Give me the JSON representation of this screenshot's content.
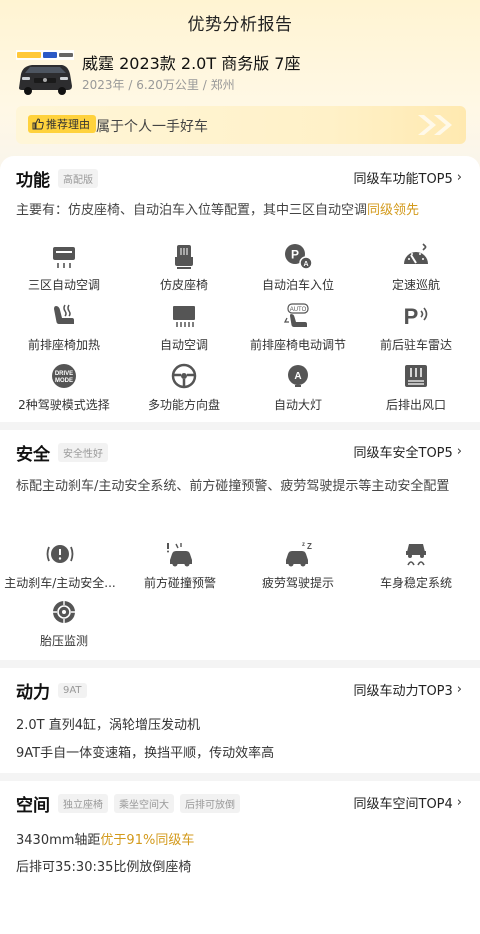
{
  "header": {
    "title": "优势分析报告"
  },
  "car": {
    "name": "威霆 2023款 2.0T 商务版 7座",
    "meta": "2023年 / 6.20万公里 / 郑州"
  },
  "reason": {
    "tag": "推荐理由",
    "text": "属于个人一手好车"
  },
  "function": {
    "title": "功能",
    "badge": "高配版",
    "top_link": "同级车功能TOP5",
    "desc_prefix": "主要有：仿皮座椅、自动泊车入位等配置，其中三区自动空调",
    "desc_highlight": "同级领先",
    "items": [
      {
        "label": "三区自动空调",
        "icon": "ac-icon"
      },
      {
        "label": "仿皮座椅",
        "icon": "seat-icon"
      },
      {
        "label": "自动泊车入位",
        "icon": "auto-park-icon"
      },
      {
        "label": "定速巡航",
        "icon": "cruise-icon"
      },
      {
        "label": "前排座椅加热",
        "icon": "seat-heat-icon"
      },
      {
        "label": "自动空调",
        "icon": "auto-ac-icon"
      },
      {
        "label": "前排座椅电动调节",
        "icon": "power-seat-icon"
      },
      {
        "label": "前后驻车雷达",
        "icon": "parking-radar-icon"
      },
      {
        "label": "2种驾驶模式选择",
        "icon": "drive-mode-icon"
      },
      {
        "label": "多功能方向盘",
        "icon": "steering-wheel-icon"
      },
      {
        "label": "自动大灯",
        "icon": "auto-light-icon"
      },
      {
        "label": "后排出风口",
        "icon": "rear-vent-icon"
      }
    ],
    "drive_mode_text": [
      "DRIVE",
      "MODE"
    ]
  },
  "safety": {
    "title": "安全",
    "badge": "安全性好",
    "top_link": "同级车安全TOP5",
    "desc": "标配主动刹车/主动安全系统、前方碰撞预警、疲劳驾驶提示等主动安全配置",
    "items": [
      {
        "label": "主动刹车/主动安全...",
        "icon": "brake-warning-icon"
      },
      {
        "label": "前方碰撞预警",
        "icon": "collision-warning-icon"
      },
      {
        "label": "疲劳驾驶提示",
        "icon": "fatigue-icon"
      },
      {
        "label": "车身稳定系统",
        "icon": "stability-icon"
      },
      {
        "label": "胎压监测",
        "icon": "tire-pressure-icon"
      }
    ]
  },
  "power": {
    "title": "动力",
    "badge": "9AT",
    "top_link": "同级车动力TOP3",
    "lines": [
      "2.0T 直列4缸，涡轮增压发动机",
      "9AT手自一体变速箱，换挡平顺，传动效率高"
    ]
  },
  "space": {
    "title": "空间",
    "badges": [
      "独立座椅",
      "乘坐空间大",
      "后排可放倒"
    ],
    "top_link": "同级车空间TOP4",
    "line1_prefix": "3430mm轴距",
    "line1_highlight": "优于91%同级车",
    "line2": "后排可35:30:35比例放倒座椅"
  },
  "colors": {
    "accent": "#d39a1c",
    "tag_yellow": "#ffd23c",
    "icon_gray": "#555555"
  },
  "chevron": "›"
}
